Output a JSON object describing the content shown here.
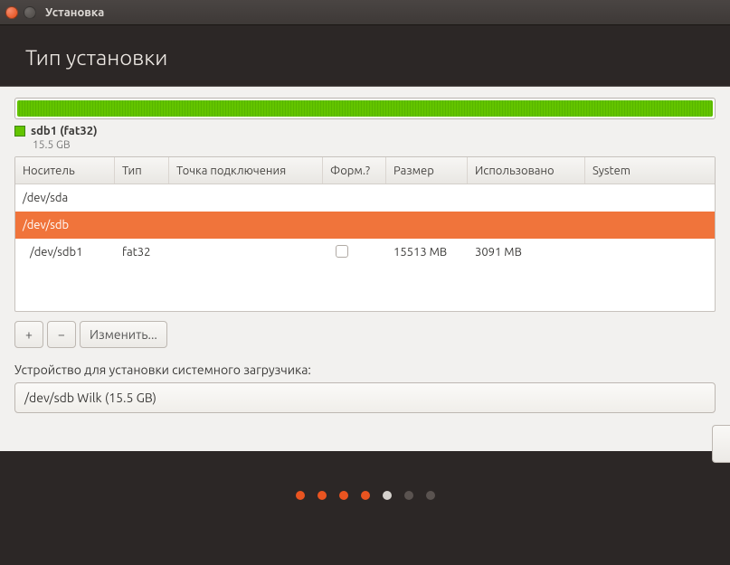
{
  "window": {
    "title": "Установка"
  },
  "header": {
    "title": "Тип установки"
  },
  "disk": {
    "partition_label": "sdb1 (fat32)",
    "partition_size": "15.5 GB"
  },
  "columns": {
    "device": "Носитель",
    "type": "Тип",
    "mount": "Точка подключения",
    "format": "Форм.?",
    "size": "Размер",
    "used": "Использовано",
    "system": "System"
  },
  "rows": {
    "sda": {
      "device": "/dev/sda"
    },
    "sdb": {
      "device": "/dev/sdb"
    },
    "sdb1": {
      "device": "/dev/sdb1",
      "type": "fat32",
      "size": "15513 MB",
      "used": "3091 MB"
    }
  },
  "toolbar": {
    "add": "+",
    "remove": "−",
    "change": "Изменить..."
  },
  "bootloader": {
    "label": "Устройство для установки системного загрузчика:",
    "value": "/dev/sdb   Wilk  (15.5 GB)"
  }
}
